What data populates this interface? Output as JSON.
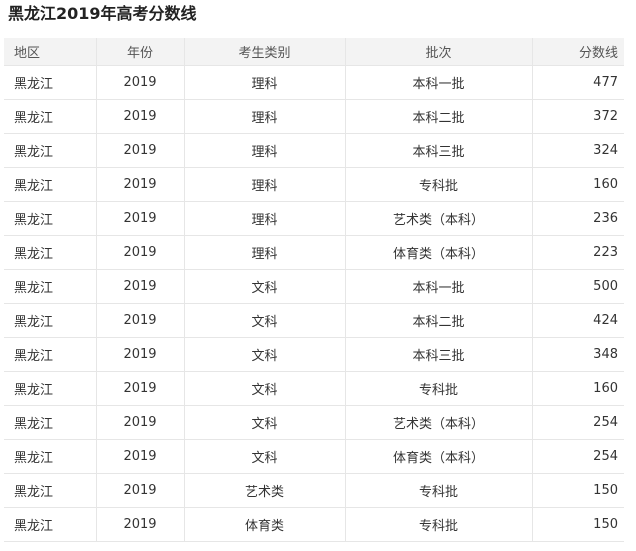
{
  "title": "黑龙江2019年高考分数线",
  "table": {
    "headers": [
      "地区",
      "年份",
      "考生类别",
      "批次",
      "分数线"
    ],
    "rows": [
      [
        "黑龙江",
        "2019",
        "理科",
        "本科一批",
        "477"
      ],
      [
        "黑龙江",
        "2019",
        "理科",
        "本科二批",
        "372"
      ],
      [
        "黑龙江",
        "2019",
        "理科",
        "本科三批",
        "324"
      ],
      [
        "黑龙江",
        "2019",
        "理科",
        "专科批",
        "160"
      ],
      [
        "黑龙江",
        "2019",
        "理科",
        "艺术类（本科）",
        "236"
      ],
      [
        "黑龙江",
        "2019",
        "理科",
        "体育类（本科）",
        "223"
      ],
      [
        "黑龙江",
        "2019",
        "文科",
        "本科一批",
        "500"
      ],
      [
        "黑龙江",
        "2019",
        "文科",
        "本科二批",
        "424"
      ],
      [
        "黑龙江",
        "2019",
        "文科",
        "本科三批",
        "348"
      ],
      [
        "黑龙江",
        "2019",
        "文科",
        "专科批",
        "160"
      ],
      [
        "黑龙江",
        "2019",
        "文科",
        "艺术类（本科）",
        "254"
      ],
      [
        "黑龙江",
        "2019",
        "文科",
        "体育类（本科）",
        "254"
      ],
      [
        "黑龙江",
        "2019",
        "艺术类",
        "专科批",
        "150"
      ],
      [
        "黑龙江",
        "2019",
        "体育类",
        "专科批",
        "150"
      ]
    ]
  }
}
